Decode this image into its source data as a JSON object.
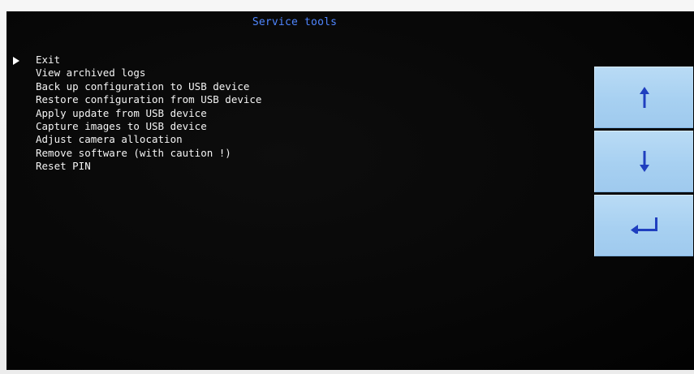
{
  "screen": {
    "title": "Service tools",
    "menu": {
      "selected_index": 0,
      "items": [
        "Exit",
        "View archived logs",
        "Back up configuration to USB device",
        "Restore configuration from USB device",
        "Apply update from USB device",
        "Capture images to USB device",
        "Adjust camera allocation",
        "Remove software (with caution !)",
        "Reset PIN"
      ]
    }
  },
  "keypad": {
    "up_icon": "arrow-up-icon",
    "down_icon": "arrow-down-icon",
    "enter_icon": "enter-return-icon",
    "button_color": "#a9d2f2",
    "icon_color": "#1f3fbf"
  },
  "colors": {
    "title": "#4f86ff",
    "menu_text": "#f4f4f4",
    "screen_bg": "#050505"
  }
}
